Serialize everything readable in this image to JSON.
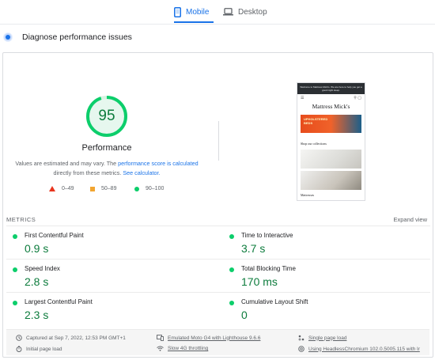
{
  "tabs": {
    "mobile_label": "Mobile",
    "desktop_label": "Desktop",
    "active": "mobile"
  },
  "header": {
    "title": "Diagnose performance issues"
  },
  "performance": {
    "score": "95",
    "score_fraction": 0.95,
    "label": "Performance",
    "note_prefix": "Values are estimated and may vary. The ",
    "note_link1": "performance score is calculated",
    "note_middle": " directly from these metrics. ",
    "note_link2": "See calculator."
  },
  "legend": {
    "fail": "0–49",
    "average": "50–89",
    "pass": "90–100"
  },
  "screenshot": {
    "banner": "Welcome to Mattress Mick's. We are here to help you get a good night sleep.",
    "brand": "Mattress Mick's",
    "hero_line1": "UPHOLSTERED",
    "hero_line2": "BEDS",
    "section": "Shop our collections",
    "footer": "Mattresses"
  },
  "metrics": {
    "heading": "METRICS",
    "expand_label": "Expand view",
    "items": [
      {
        "label": "First Contentful Paint",
        "value": "0.9 s"
      },
      {
        "label": "Time to Interactive",
        "value": "3.7 s"
      },
      {
        "label": "Speed Index",
        "value": "2.8 s"
      },
      {
        "label": "Total Blocking Time",
        "value": "170 ms"
      },
      {
        "label": "Largest Contentful Paint",
        "value": "2.3 s"
      },
      {
        "label": "Cumulative Layout Shift",
        "value": "0"
      }
    ]
  },
  "footer": {
    "captured": "Captured at Sep 7, 2022, 12:53 PM GMT+1",
    "device": "Emulated Moto G4 with Lighthouse 9.6.6",
    "session": "Single page load",
    "initial": "Initial page load",
    "throttling": "Slow 4G throttling",
    "browser": "Using HeadlessChromium 102.0.5005.115 with lr"
  },
  "colors": {
    "accent": "#1a73e8",
    "pass": "#0cce6b",
    "pass_text": "#0d7c3d",
    "average": "#f2a531",
    "fail": "#e8351e"
  }
}
